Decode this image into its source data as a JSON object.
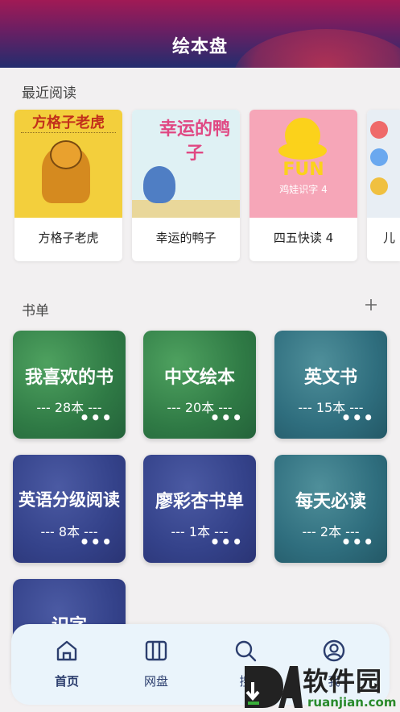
{
  "header": {
    "title": "绘本盘"
  },
  "recent": {
    "label": "最近阅读",
    "books": [
      {
        "title": "方格子老虎",
        "cover_text": "方格子老虎"
      },
      {
        "title": "幸运的鸭子",
        "cover_text": "幸运的鸭子"
      },
      {
        "title": "四五快读 4",
        "cover_text": "FUN",
        "cover_sub": "鸡娃识字 4"
      },
      {
        "title": "儿"
      }
    ]
  },
  "booklists": {
    "label": "书单",
    "add_icon": "plus-icon",
    "items": [
      {
        "name": "我喜欢的书",
        "count": "--- 28本 ---",
        "more": "•••",
        "color": "green"
      },
      {
        "name": "中文绘本",
        "count": "--- 20本 ---",
        "more": "•••",
        "color": "green"
      },
      {
        "name": "英文书",
        "count": "--- 15本 ---",
        "more": "•••",
        "color": "teal"
      },
      {
        "name": "英语分级阅读",
        "count": "--- 8本 ---",
        "more": "•••",
        "color": "indigo"
      },
      {
        "name": "廖彩杏书单",
        "count": "--- 1本 ---",
        "more": "•••",
        "color": "indigo"
      },
      {
        "name": "每天必读",
        "count": "--- 2本 ---",
        "more": "•••",
        "color": "teal"
      },
      {
        "name": "识字",
        "color": "indigo"
      }
    ]
  },
  "tabbar": {
    "tabs": [
      {
        "label": "首页",
        "icon": "home-icon",
        "active": true
      },
      {
        "label": "网盘",
        "icon": "columns-icon",
        "active": false
      },
      {
        "label": "搜",
        "icon": "search-icon",
        "active": false
      },
      {
        "label": "我",
        "icon": "user-icon",
        "active": false
      }
    ]
  },
  "watermark": {
    "text": "软件园",
    "url": "ruanjian.com",
    "logo": "DA"
  },
  "colors": {
    "accent": "#2c3e6e",
    "green": "#2f7a45",
    "teal": "#2f6e7e",
    "indigo": "#34428a"
  }
}
